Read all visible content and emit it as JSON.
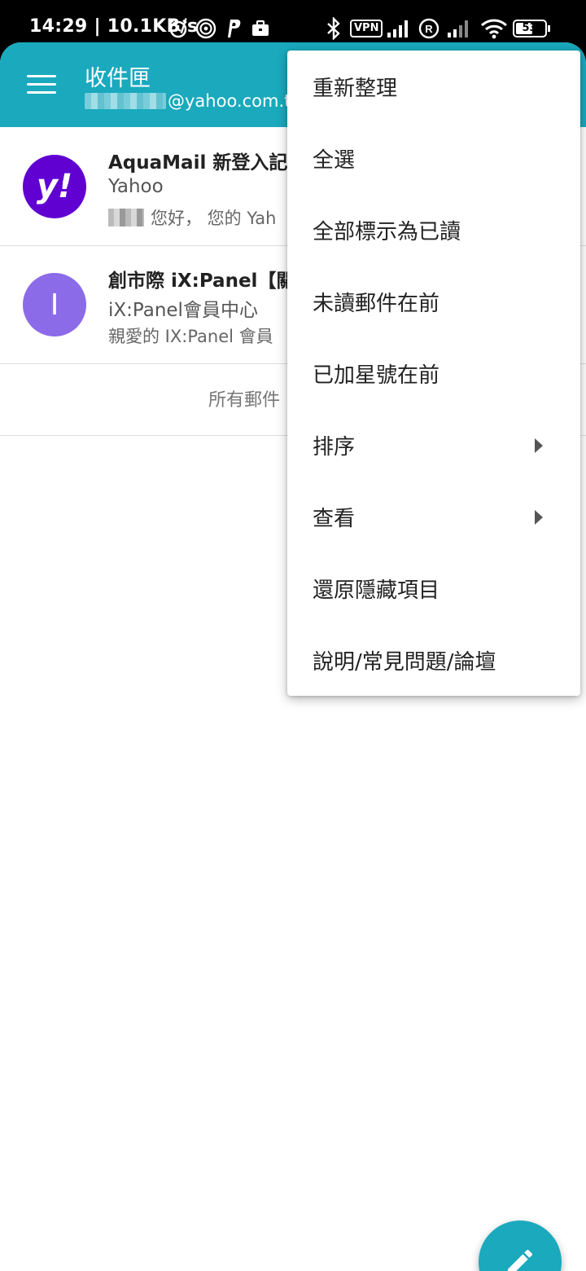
{
  "status_bar": {
    "time": "14:29 | 10.1KB/s",
    "vpn_label": "VPN",
    "battery": "53"
  },
  "app_bar": {
    "title": "收件匣",
    "account_suffix": "@yahoo.com.tw"
  },
  "messages": [
    {
      "subject": "AquaMail 新登入記",
      "sender": "Yahoo",
      "snippet": "您好， 您的 Yah",
      "avatar_text": "y!",
      "avatar_color": "#6001d2"
    },
    {
      "subject": "創市際 iX:Panel【關",
      "sender": "iX:Panel會員中心",
      "snippet": "親愛的 IX:Panel 會員",
      "avatar_text": "I",
      "avatar_color": "#8c6be8"
    }
  ],
  "all_mail_label": "所有郵件",
  "menu": {
    "items": [
      {
        "label": "重新整理",
        "submenu": false
      },
      {
        "label": "全選",
        "submenu": false
      },
      {
        "label": "全部標示為已讀",
        "submenu": false
      },
      {
        "label": "未讀郵件在前",
        "submenu": false
      },
      {
        "label": "已加星號在前",
        "submenu": false
      },
      {
        "label": "排序",
        "submenu": true
      },
      {
        "label": "查看",
        "submenu": true
      },
      {
        "label": "還原隱藏項目",
        "submenu": false
      },
      {
        "label": "說明/常見問題/論壇",
        "submenu": false
      }
    ]
  },
  "colors": {
    "accent": "#1aa9bd"
  },
  "icons": {
    "fab": "pencil-icon"
  }
}
